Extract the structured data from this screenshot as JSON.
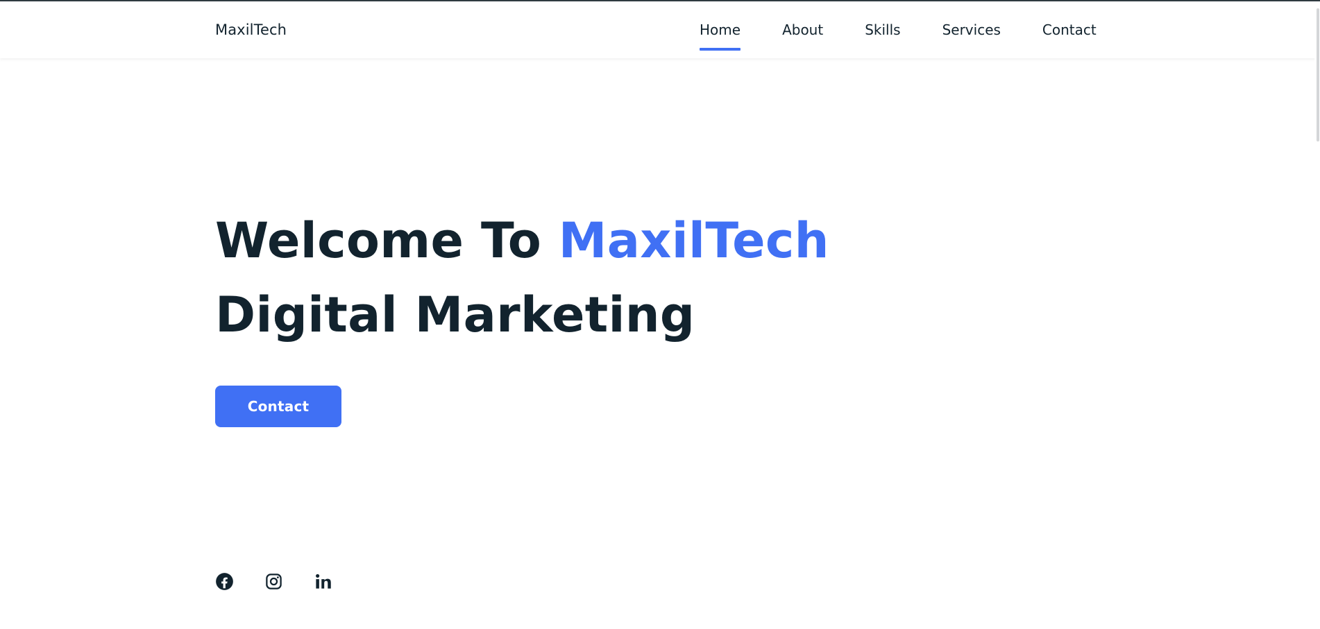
{
  "brand": {
    "logo": "MaxilTech"
  },
  "nav": {
    "items": [
      {
        "label": "Home",
        "active": true
      },
      {
        "label": "About",
        "active": false
      },
      {
        "label": "Skills",
        "active": false
      },
      {
        "label": "Services",
        "active": false
      },
      {
        "label": "Contact",
        "active": false
      }
    ]
  },
  "hero": {
    "title_prefix": "Welcome To ",
    "title_accent": "MaxilTech",
    "title_line2": "Digital Marketing",
    "button_label": "Contact"
  },
  "socials": [
    {
      "name": "facebook",
      "icon": "facebook-icon"
    },
    {
      "name": "instagram",
      "icon": "instagram-icon"
    },
    {
      "name": "linkedin",
      "icon": "linkedin-icon"
    }
  ],
  "colors": {
    "accent": "#4070f4",
    "text": "#12232e",
    "background": "#ffffff"
  }
}
